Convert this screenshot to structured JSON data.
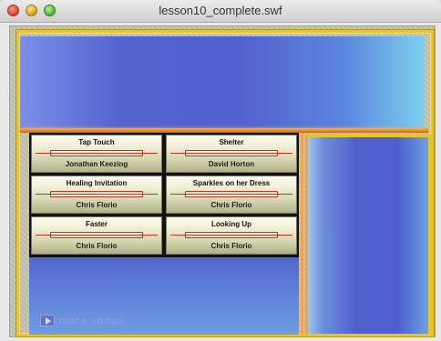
{
  "window": {
    "title": "lesson10_complete.swf"
  },
  "songs": [
    {
      "title": "Tap Touch",
      "artist": "Jonathan Keezing"
    },
    {
      "title": "Shelter",
      "artist": "David Horton"
    },
    {
      "title": "Healing Invitation",
      "artist": "Chris Florio"
    },
    {
      "title": "Sparkles on her Dress",
      "artist": "Chris Florio"
    },
    {
      "title": "Faster",
      "artist": "Chris Florio"
    },
    {
      "title": "Looking Up",
      "artist": "Chris Florio"
    }
  ],
  "footer": {
    "more_songs_label": "more songs"
  },
  "colors": {
    "banner_blue": "#5462d0",
    "accent_orange": "#f08a1e",
    "frame_yellow": "#e6c52a"
  }
}
